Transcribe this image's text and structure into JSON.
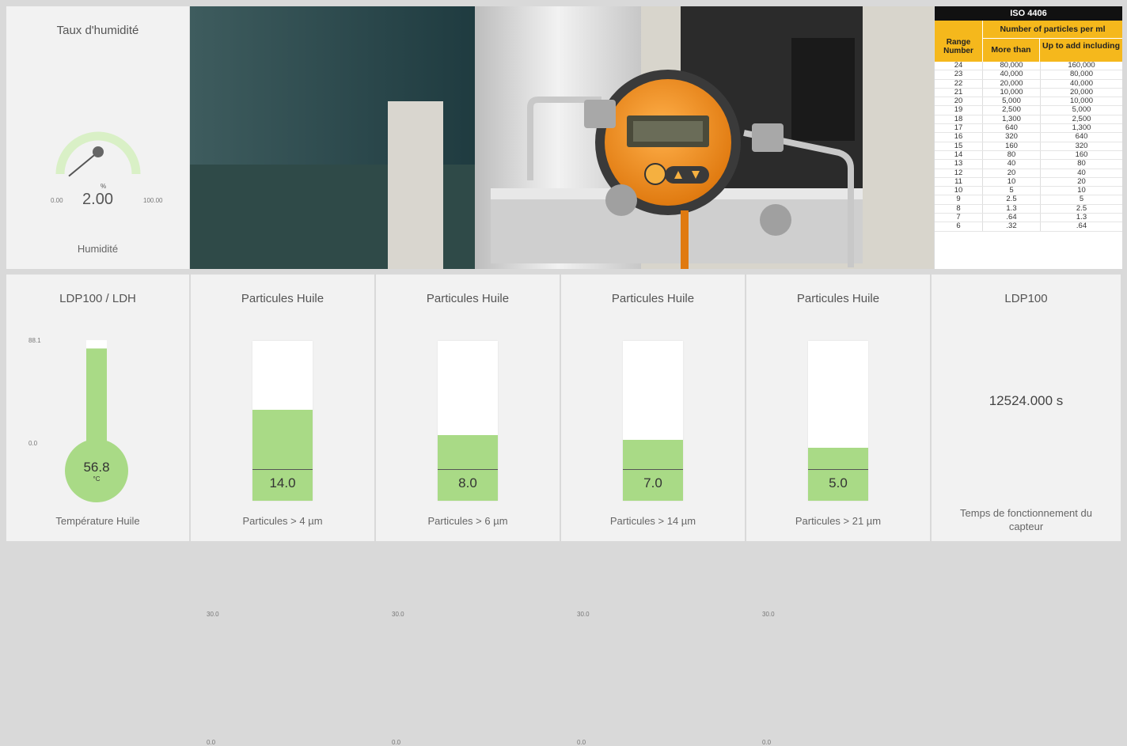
{
  "gauge_panel": {
    "title": "Taux d'humidité",
    "min": "0.00",
    "max": "100.00",
    "unit": "%",
    "value": "2.00",
    "fraction": 0.02,
    "footer": "Humidité"
  },
  "iso_table": {
    "title": "ISO 4406",
    "header_group": "Number of particles per ml",
    "col_range": "Range Number",
    "col_more": "More than",
    "col_upto": "Up to add including",
    "rows": [
      [
        "24",
        "80,000",
        "160,000"
      ],
      [
        "23",
        "40,000",
        "80,000"
      ],
      [
        "22",
        "20,000",
        "40,000"
      ],
      [
        "21",
        "10,000",
        "20,000"
      ],
      [
        "20",
        "5,000",
        "10,000"
      ],
      [
        "19",
        "2,500",
        "5,000"
      ],
      [
        "18",
        "1,300",
        "2,500"
      ],
      [
        "17",
        "640",
        "1,300"
      ],
      [
        "16",
        "320",
        "640"
      ],
      [
        "15",
        "160",
        "320"
      ],
      [
        "14",
        "80",
        "160"
      ],
      [
        "13",
        "40",
        "80"
      ],
      [
        "12",
        "20",
        "40"
      ],
      [
        "11",
        "10",
        "20"
      ],
      [
        "10",
        "5",
        "10"
      ],
      [
        "9",
        "2.5",
        "5"
      ],
      [
        "8",
        "1.3",
        "2.5"
      ],
      [
        "7",
        ".64",
        "1.3"
      ],
      [
        "6",
        ".32",
        ".64"
      ]
    ]
  },
  "thermo_panel": {
    "title": "LDP100 / LDH",
    "max": "88.1",
    "min": "0.0",
    "value": "56.8",
    "unit": "°C",
    "fraction": 0.93,
    "footer": "Température Huile"
  },
  "levels": [
    {
      "title": "Particules Huile",
      "max": "30.0",
      "min": "0.0",
      "value": "14.0",
      "fraction": 0.57,
      "footer": "Particules > 4 µm"
    },
    {
      "title": "Particules Huile",
      "max": "30.0",
      "min": "0.0",
      "value": "8.0",
      "fraction": 0.41,
      "footer": "Particules > 6 µm"
    },
    {
      "title": "Particules Huile",
      "max": "30.0",
      "min": "0.0",
      "value": "7.0",
      "fraction": 0.38,
      "footer": "Particules > 14 µm"
    },
    {
      "title": "Particules Huile",
      "max": "30.0",
      "min": "0.0",
      "value": "5.0",
      "fraction": 0.33,
      "footer": "Particules > 21 µm"
    }
  ],
  "counter_panel": {
    "title": "LDP100",
    "value": "12524.000 s",
    "footer": "Temps de fonctionnement du capteur"
  },
  "colors": {
    "fill": "#a9da86",
    "arc_track": "#d9f0c6",
    "panel": "#f2f2f2",
    "table_header": "#f5b81c"
  }
}
